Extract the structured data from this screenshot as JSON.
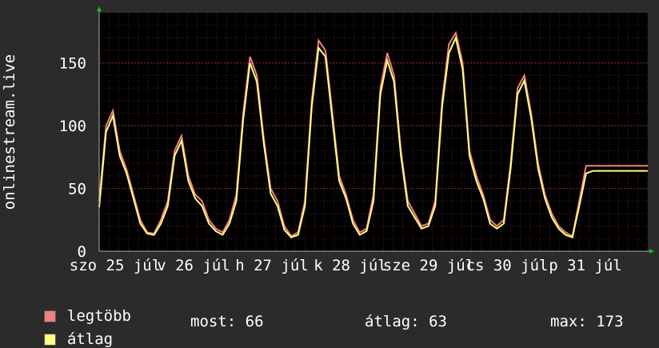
{
  "chart_data": {
    "type": "line",
    "title": "",
    "ylabel": "onlinestream.live",
    "xlabel": "",
    "ylim": [
      0,
      190
    ],
    "yticks": [
      0,
      50,
      100,
      150
    ],
    "x_range": [
      0,
      7
    ],
    "x_tick_labels": [
      {
        "label": "szo 25 júl",
        "x": 0.0
      },
      {
        "label": "v 26 júl",
        "x": 0.5
      },
      {
        "label": "h 27 júl",
        "x": 1.0
      },
      {
        "label": "k 28 júl",
        "x": 1.5
      },
      {
        "label": "sze 29 júl",
        "x": 2.0
      },
      {
        "label": "cs 30 júl",
        "x": 2.5
      },
      {
        "label": "p 31 júl",
        "x": 3.0
      }
    ],
    "grid": true,
    "colors": {
      "background": "#2b2b2b",
      "plot_bg": "#000000",
      "grid": "#4a2020",
      "legtobb": "#f08080",
      "atlag": "#ffff80",
      "axis_arrow": "#00cc00"
    },
    "series": [
      {
        "name": "legtöbb",
        "color": "#f08080",
        "x": [
          0,
          0.05,
          0.1,
          0.15,
          0.2,
          0.25,
          0.3,
          0.35,
          0.4,
          0.45,
          0.5,
          0.55,
          0.6,
          0.65,
          0.7,
          0.75,
          0.8,
          0.85,
          0.9,
          0.95,
          1.0,
          1.05,
          1.1,
          1.15,
          1.2,
          1.25,
          1.3,
          1.35,
          1.4,
          1.45,
          1.5,
          1.55,
          1.6,
          1.65,
          1.7,
          1.75,
          1.8,
          1.85,
          1.9,
          1.95,
          2.0,
          2.05,
          2.1,
          2.15,
          2.2,
          2.25,
          2.3,
          2.35,
          2.4,
          2.45,
          2.5,
          2.55,
          2.6,
          2.65,
          2.7,
          2.75,
          2.8,
          2.85,
          2.9,
          2.95,
          3.0,
          3.05,
          3.1,
          3.15,
          3.2,
          3.25,
          3.3,
          3.35,
          3.4,
          3.45,
          3.5,
          3.55,
          3.6,
          3.65,
          3.7,
          3.75,
          3.8,
          3.85,
          3.9,
          3.95,
          4.0
        ],
        "values": [
          40,
          100,
          112,
          80,
          65,
          45,
          25,
          15,
          14,
          25,
          40,
          80,
          92,
          60,
          45,
          40,
          25,
          18,
          15,
          25,
          45,
          110,
          155,
          140,
          90,
          50,
          40,
          20,
          12,
          15,
          40,
          120,
          168,
          160,
          110,
          60,
          45,
          25,
          15,
          18,
          45,
          130,
          158,
          140,
          80,
          40,
          30,
          20,
          22,
          40,
          120,
          165,
          174,
          150,
          80,
          60,
          45,
          25,
          20,
          25,
          70,
          130,
          140,
          110,
          70,
          45,
          30,
          20,
          15,
          12,
          40,
          68,
          68,
          68,
          68,
          68,
          68,
          68,
          68,
          68,
          68
        ]
      },
      {
        "name": "átlag",
        "color": "#ffff80",
        "x": [
          0,
          0.05,
          0.1,
          0.15,
          0.2,
          0.25,
          0.3,
          0.35,
          0.4,
          0.45,
          0.5,
          0.55,
          0.6,
          0.65,
          0.7,
          0.75,
          0.8,
          0.85,
          0.9,
          0.95,
          1.0,
          1.05,
          1.1,
          1.15,
          1.2,
          1.25,
          1.3,
          1.35,
          1.4,
          1.45,
          1.5,
          1.55,
          1.6,
          1.65,
          1.7,
          1.75,
          1.8,
          1.85,
          1.9,
          1.95,
          2.0,
          2.05,
          2.1,
          2.15,
          2.2,
          2.25,
          2.3,
          2.35,
          2.4,
          2.45,
          2.5,
          2.55,
          2.6,
          2.65,
          2.7,
          2.75,
          2.8,
          2.85,
          2.9,
          2.95,
          3.0,
          3.05,
          3.1,
          3.15,
          3.2,
          3.25,
          3.3,
          3.35,
          3.4,
          3.45,
          3.5,
          3.55,
          3.6,
          3.65,
          3.7,
          3.75,
          3.8,
          3.85,
          3.9,
          3.95,
          4.0
        ],
        "values": [
          35,
          95,
          108,
          76,
          62,
          42,
          22,
          14,
          13,
          22,
          36,
          76,
          88,
          56,
          42,
          36,
          22,
          16,
          13,
          22,
          40,
          105,
          150,
          135,
          86,
          46,
          36,
          17,
          11,
          13,
          36,
          115,
          162,
          155,
          105,
          56,
          42,
          22,
          13,
          16,
          40,
          125,
          152,
          135,
          76,
          36,
          27,
          18,
          20,
          36,
          115,
          158,
          170,
          145,
          76,
          56,
          42,
          22,
          18,
          22,
          66,
          125,
          136,
          106,
          66,
          42,
          27,
          18,
          13,
          11,
          36,
          62,
          64,
          64,
          64,
          64,
          64,
          64,
          64,
          64,
          64
        ]
      }
    ]
  },
  "legend": {
    "items": [
      {
        "label": "legtöbb",
        "color": "#f08080"
      },
      {
        "label": "átlag",
        "color": "#ffff80"
      }
    ]
  },
  "stats": {
    "most": "most: 66",
    "atlag": "átlag: 63",
    "max": "max: 173"
  }
}
